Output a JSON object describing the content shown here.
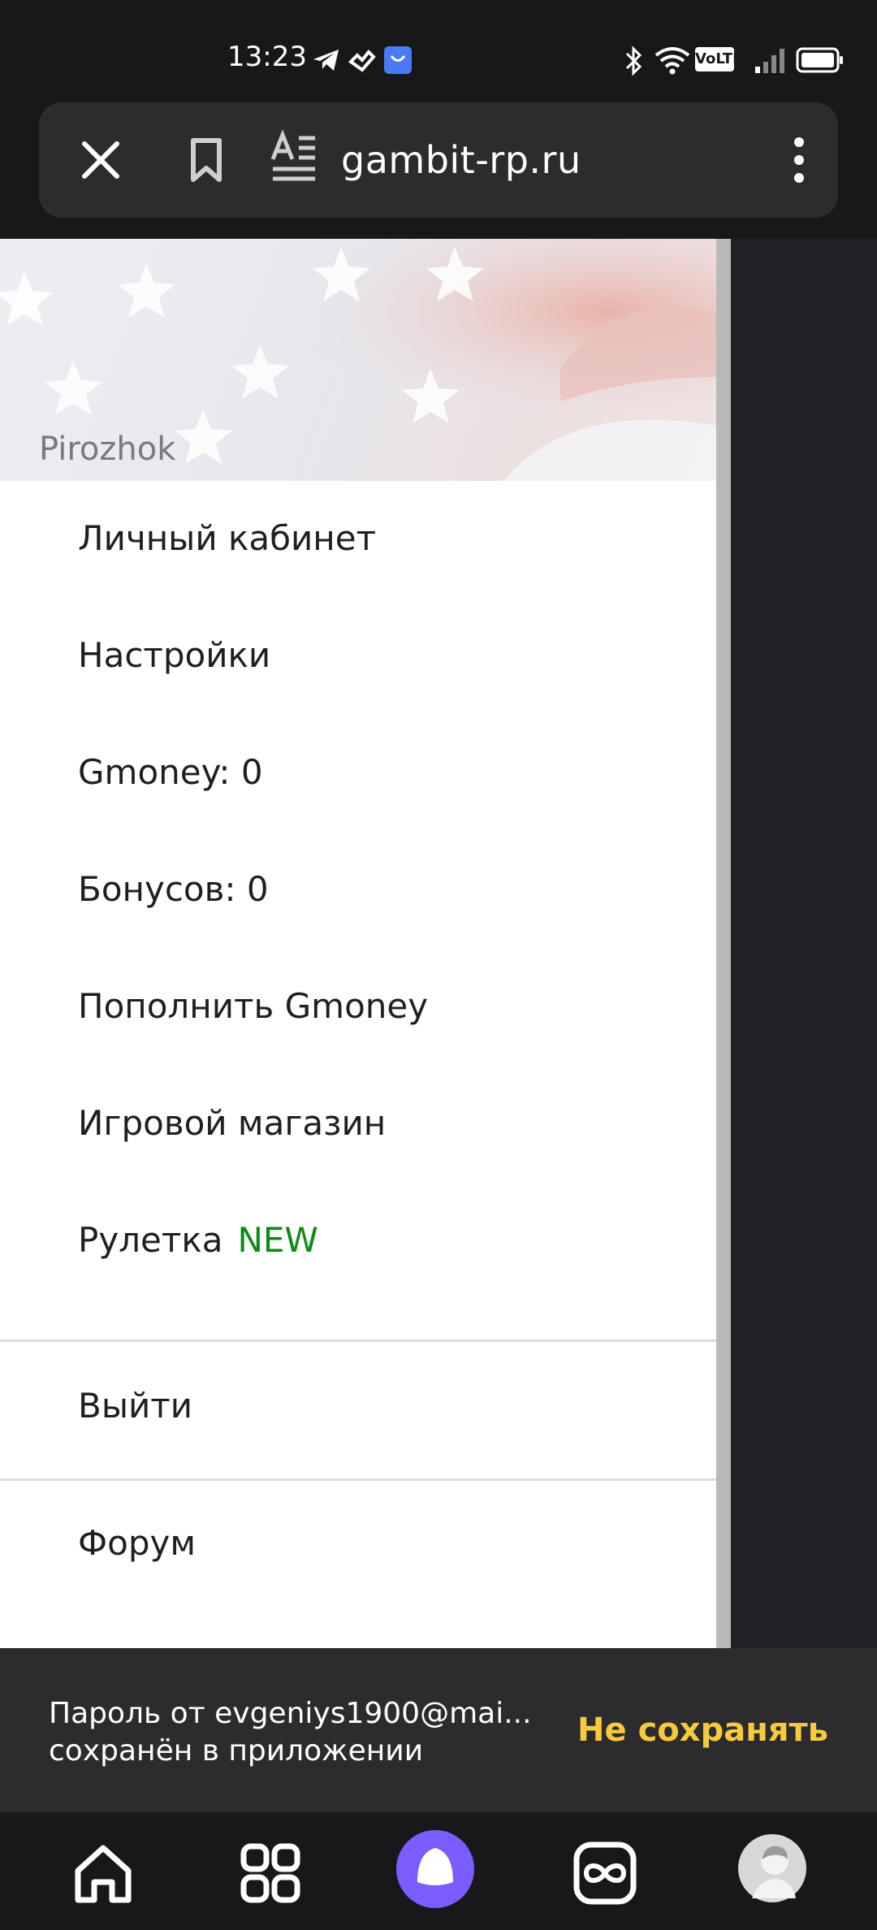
{
  "status_bar": {
    "time": "13:23",
    "left_icons": [
      "telegram-icon",
      "app-icon",
      "store-icon"
    ],
    "right_icons": [
      "bluetooth-icon",
      "wifi-icon",
      "volte-icon",
      "signal-icon",
      "battery-icon"
    ],
    "volte_label": "VoLTE"
  },
  "browser": {
    "url": "gambit-rp.ru"
  },
  "drawer": {
    "username": "Pirozhok",
    "items": [
      {
        "label": "Личный кабинет"
      },
      {
        "label": "Настройки"
      },
      {
        "label": "Gmoney: 0"
      },
      {
        "label": "Бонусов: 0"
      },
      {
        "label": "Пополнить Gmoney"
      },
      {
        "label": "Игровой магазин"
      },
      {
        "label": "Рулетка",
        "badge": "NEW"
      }
    ],
    "logout": "Выйти",
    "forum": "Форум"
  },
  "toast": {
    "line1": "Пароль от evgeniys1900@mai...",
    "line2": "сохранён в приложении",
    "action": "Не сохранять"
  },
  "colors": {
    "badge_new": "#0e8a16",
    "toast_action": "#f7ca3e",
    "alice_accent": "#7b5cff"
  }
}
